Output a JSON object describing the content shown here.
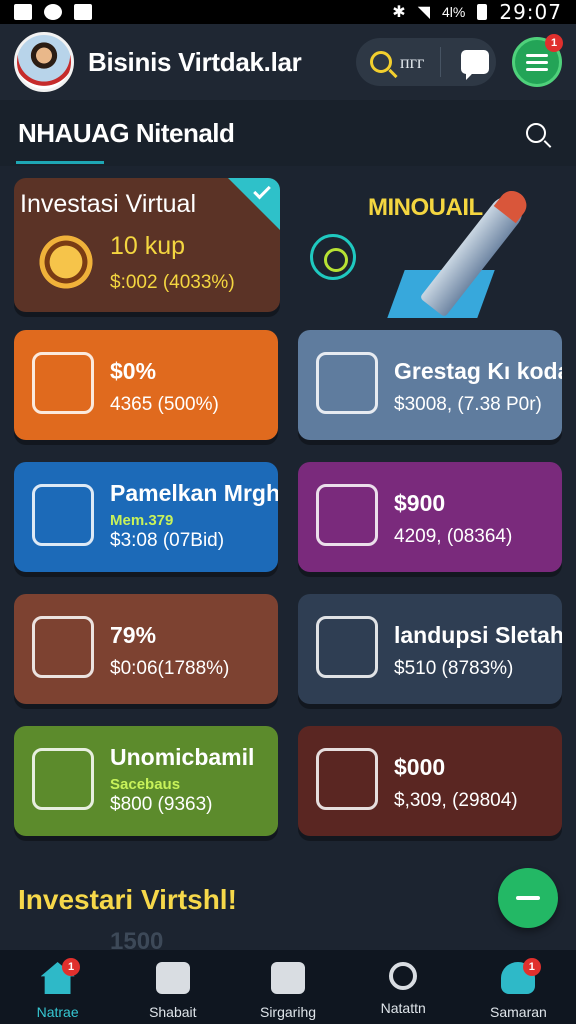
{
  "status_bar": {
    "time": "29:07",
    "battery": "4l%"
  },
  "header": {
    "title": "Bisinis Virtdak.lar",
    "search_text": "пгг",
    "menu_badge": "1"
  },
  "section": {
    "title": "NHAUAG Nitenald"
  },
  "featured_card": {
    "title": "Investasi Virtual",
    "value": "10 kup",
    "sub": "$:002 (4033%)"
  },
  "hero": {
    "label": "MINOUAIL"
  },
  "cards": [
    {
      "title": "$0%",
      "sub": "4365 (500%)",
      "mini": "",
      "bg": "#e06a1e",
      "icon": "coin-target-icon"
    },
    {
      "title": "Grestag Kı koda",
      "sub": "$3008, (7.38 P0r)",
      "mini": "",
      "bg": "#5f7c9e",
      "icon": "money-hand-icon"
    },
    {
      "title": "Pamelkan Mrghio",
      "sub": "$3:08 (07Bid)",
      "mini": "Mem.379",
      "bg": "#1c6ab8",
      "icon": "user-chart-icon"
    },
    {
      "title": "$900",
      "sub": "4209, (08364)",
      "mini": "",
      "bg": "#7a2a7c",
      "icon": "monitor-chart-icon"
    },
    {
      "title": "79%",
      "sub": "$0:06(1788%)",
      "mini": "",
      "bg": "#7d4231",
      "icon": "document-money-icon"
    },
    {
      "title": "landupsi Sletah",
      "sub": "$510 (8783%)",
      "mini": "",
      "bg": "#2f3e53",
      "icon": "plug-icon"
    },
    {
      "title": "Unomicbamil",
      "sub": "$800 (9363)",
      "mini": "Sacebaus",
      "bg": "#5c8b2c",
      "icon": "gear-location-icon"
    },
    {
      "title": "$000",
      "sub": "$,309, (29804)",
      "mini": "",
      "bg": "#5a2622",
      "icon": "house-money-icon"
    }
  ],
  "footer": {
    "heading": "Investari Virtshl!",
    "ghost_value": "1500"
  },
  "nav": [
    {
      "label": "Natrae",
      "badge": "1",
      "icon": "home-icon"
    },
    {
      "label": "Shabait",
      "badge": "",
      "icon": "bag-icon"
    },
    {
      "label": "Sirgarihg",
      "badge": "",
      "icon": "card-icon"
    },
    {
      "label": "Natattn",
      "badge": "",
      "icon": "search-icon"
    },
    {
      "label": "Samaran",
      "badge": "1",
      "icon": "user-icon"
    }
  ],
  "colors": {
    "accent": "#1ea7b5",
    "gold": "#f4d640",
    "green": "#23b865"
  }
}
